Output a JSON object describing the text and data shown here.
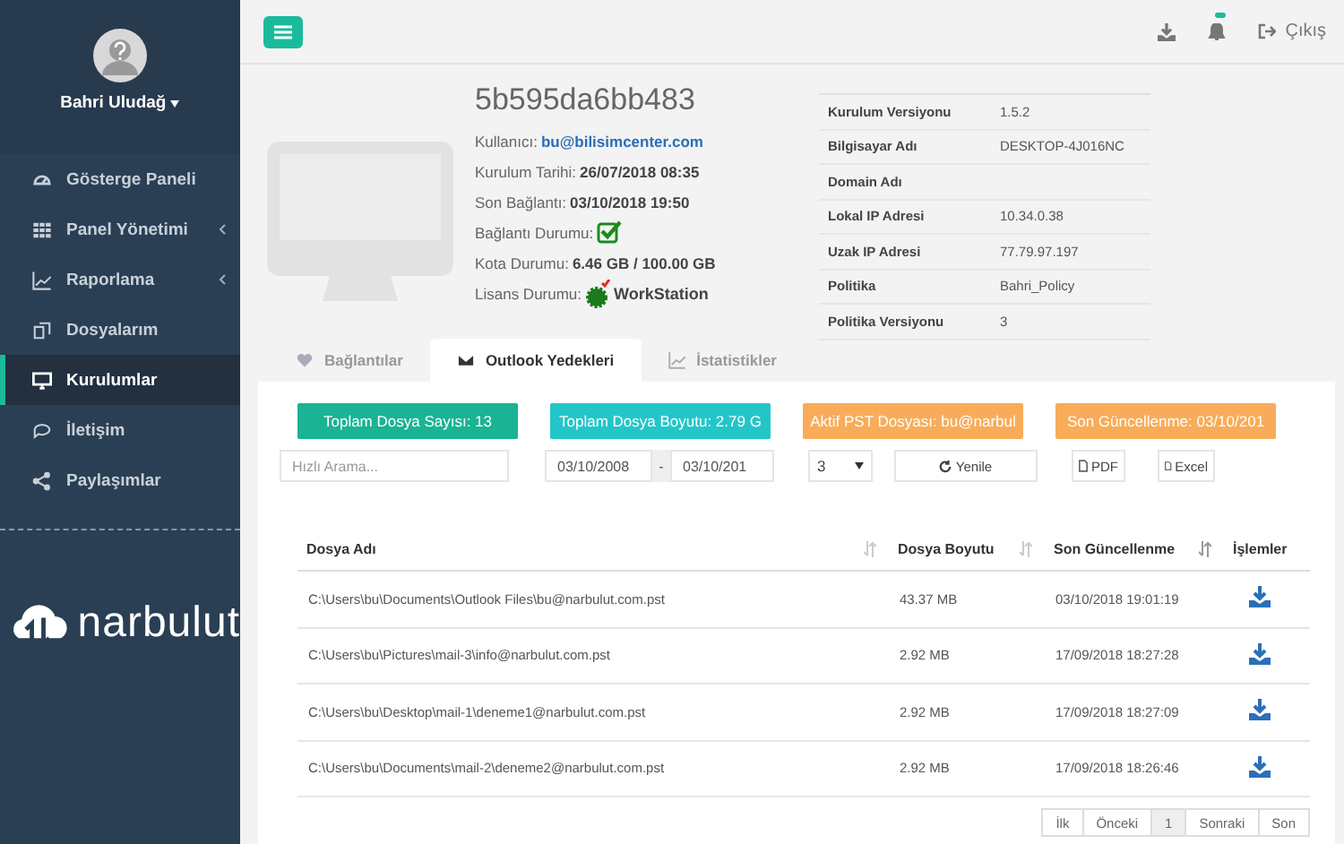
{
  "sidebar": {
    "user": {
      "name": "Bahri Uludağ"
    },
    "items": [
      {
        "label": "Gösterge Paneli",
        "selected": false,
        "expandable": false
      },
      {
        "label": "Panel Yönetimi",
        "selected": false,
        "expandable": true
      },
      {
        "label": "Raporlama",
        "selected": false,
        "expandable": true
      },
      {
        "label": "Dosyalarım",
        "selected": false,
        "expandable": false
      },
      {
        "label": "Kurulumlar",
        "selected": true,
        "expandable": false
      },
      {
        "label": "İletişim",
        "selected": false,
        "expandable": false
      },
      {
        "label": "Paylaşımlar",
        "selected": false,
        "expandable": false
      }
    ],
    "logo": {
      "text": "narbulut"
    }
  },
  "topbar": {
    "logout": "Çıkış",
    "notification": true
  },
  "device": {
    "id": "5b595da6bb483",
    "fields": [
      {
        "label": "Kullanıcı:",
        "value": "bu@bilisimcenter.com",
        "kind": "link"
      },
      {
        "label": "Kurulum Tarihi:",
        "value": "26/07/2018 08:35",
        "kind": "text"
      },
      {
        "label": "Son Bağlantı:",
        "value": "03/10/2018 19:50",
        "kind": "text"
      },
      {
        "label": "Bağlantı Durumu:",
        "kind": "check"
      },
      {
        "label": "Kota Durumu:",
        "value": "6.46 GB / 100.00 GB",
        "kind": "text"
      },
      {
        "label": "Lisans Durumu:",
        "value": "WorkStation",
        "kind": "license"
      }
    ],
    "properties": [
      {
        "label": "Kurulum Versiyonu",
        "value": "1.5.2"
      },
      {
        "label": "Bilgisayar Adı",
        "value": "DESKTOP-4J016NC"
      },
      {
        "label": "Domain Adı"
      },
      {
        "label": "Lokal IP Adresi",
        "value": "10.34.0.38"
      },
      {
        "label": "Uzak IP Adresi",
        "value": "77.79.97.197"
      },
      {
        "label": "Politika",
        "value": "Bahri_Policy"
      },
      {
        "label": "Politika Versiyonu",
        "value": "3"
      }
    ]
  },
  "tabs": [
    {
      "label": "Bağlantılar",
      "selected": false
    },
    {
      "label": "Outlook Yedekleri",
      "selected": true
    },
    {
      "label": "İstatistikler",
      "selected": false
    }
  ],
  "stats": [
    {
      "text": "Toplam Dosya Sayısı: 13",
      "color": "#1ab394"
    },
    {
      "text": "Toplam Dosya Boyutu: 2.79 G",
      "color": "#23c6c8"
    },
    {
      "text": "Aktif PST Dosyası: bu@narbul",
      "color": "#f8ac59"
    },
    {
      "text": "Son Güncellenme: 03/10/201",
      "color": "#f8ac59"
    }
  ],
  "filters": {
    "search": {
      "placeholder": "Hızlı Arama..."
    },
    "date_from": "03/10/2008",
    "date_separator": "-",
    "date_to": "03/10/201",
    "page_size": "3",
    "refresh": "Yenile",
    "pdf": "PDF",
    "excel": "Excel"
  },
  "table": {
    "columns": [
      "Dosya Adı",
      "Dosya Boyutu",
      "Son Güncellenme",
      "İşlemler"
    ],
    "rows": [
      [
        "C:\\Users\\bu\\Documents\\Outlook Files\\bu@narbulut.com.pst",
        "43.37 MB",
        "03/10/2018 19:01:19"
      ],
      [
        "C:\\Users\\bu\\Pictures\\mail-3\\info@narbulut.com.pst",
        "2.92 MB",
        "17/09/2018 18:27:28"
      ],
      [
        "C:\\Users\\bu\\Desktop\\mail-1\\deneme1@narbulut.com.pst",
        "2.92 MB",
        "17/09/2018 18:27:09"
      ],
      [
        "C:\\Users\\bu\\Documents\\mail-2\\deneme2@narbulut.com.pst",
        "2.92 MB",
        "17/09/2018 18:26:46"
      ]
    ]
  },
  "pagination": [
    {
      "label": "İlk",
      "selected": false
    },
    {
      "label": "Önceki",
      "selected": false
    },
    {
      "label": "1",
      "selected": true
    },
    {
      "label": "Sonraki",
      "selected": false
    },
    {
      "label": "Son",
      "selected": false
    }
  ]
}
